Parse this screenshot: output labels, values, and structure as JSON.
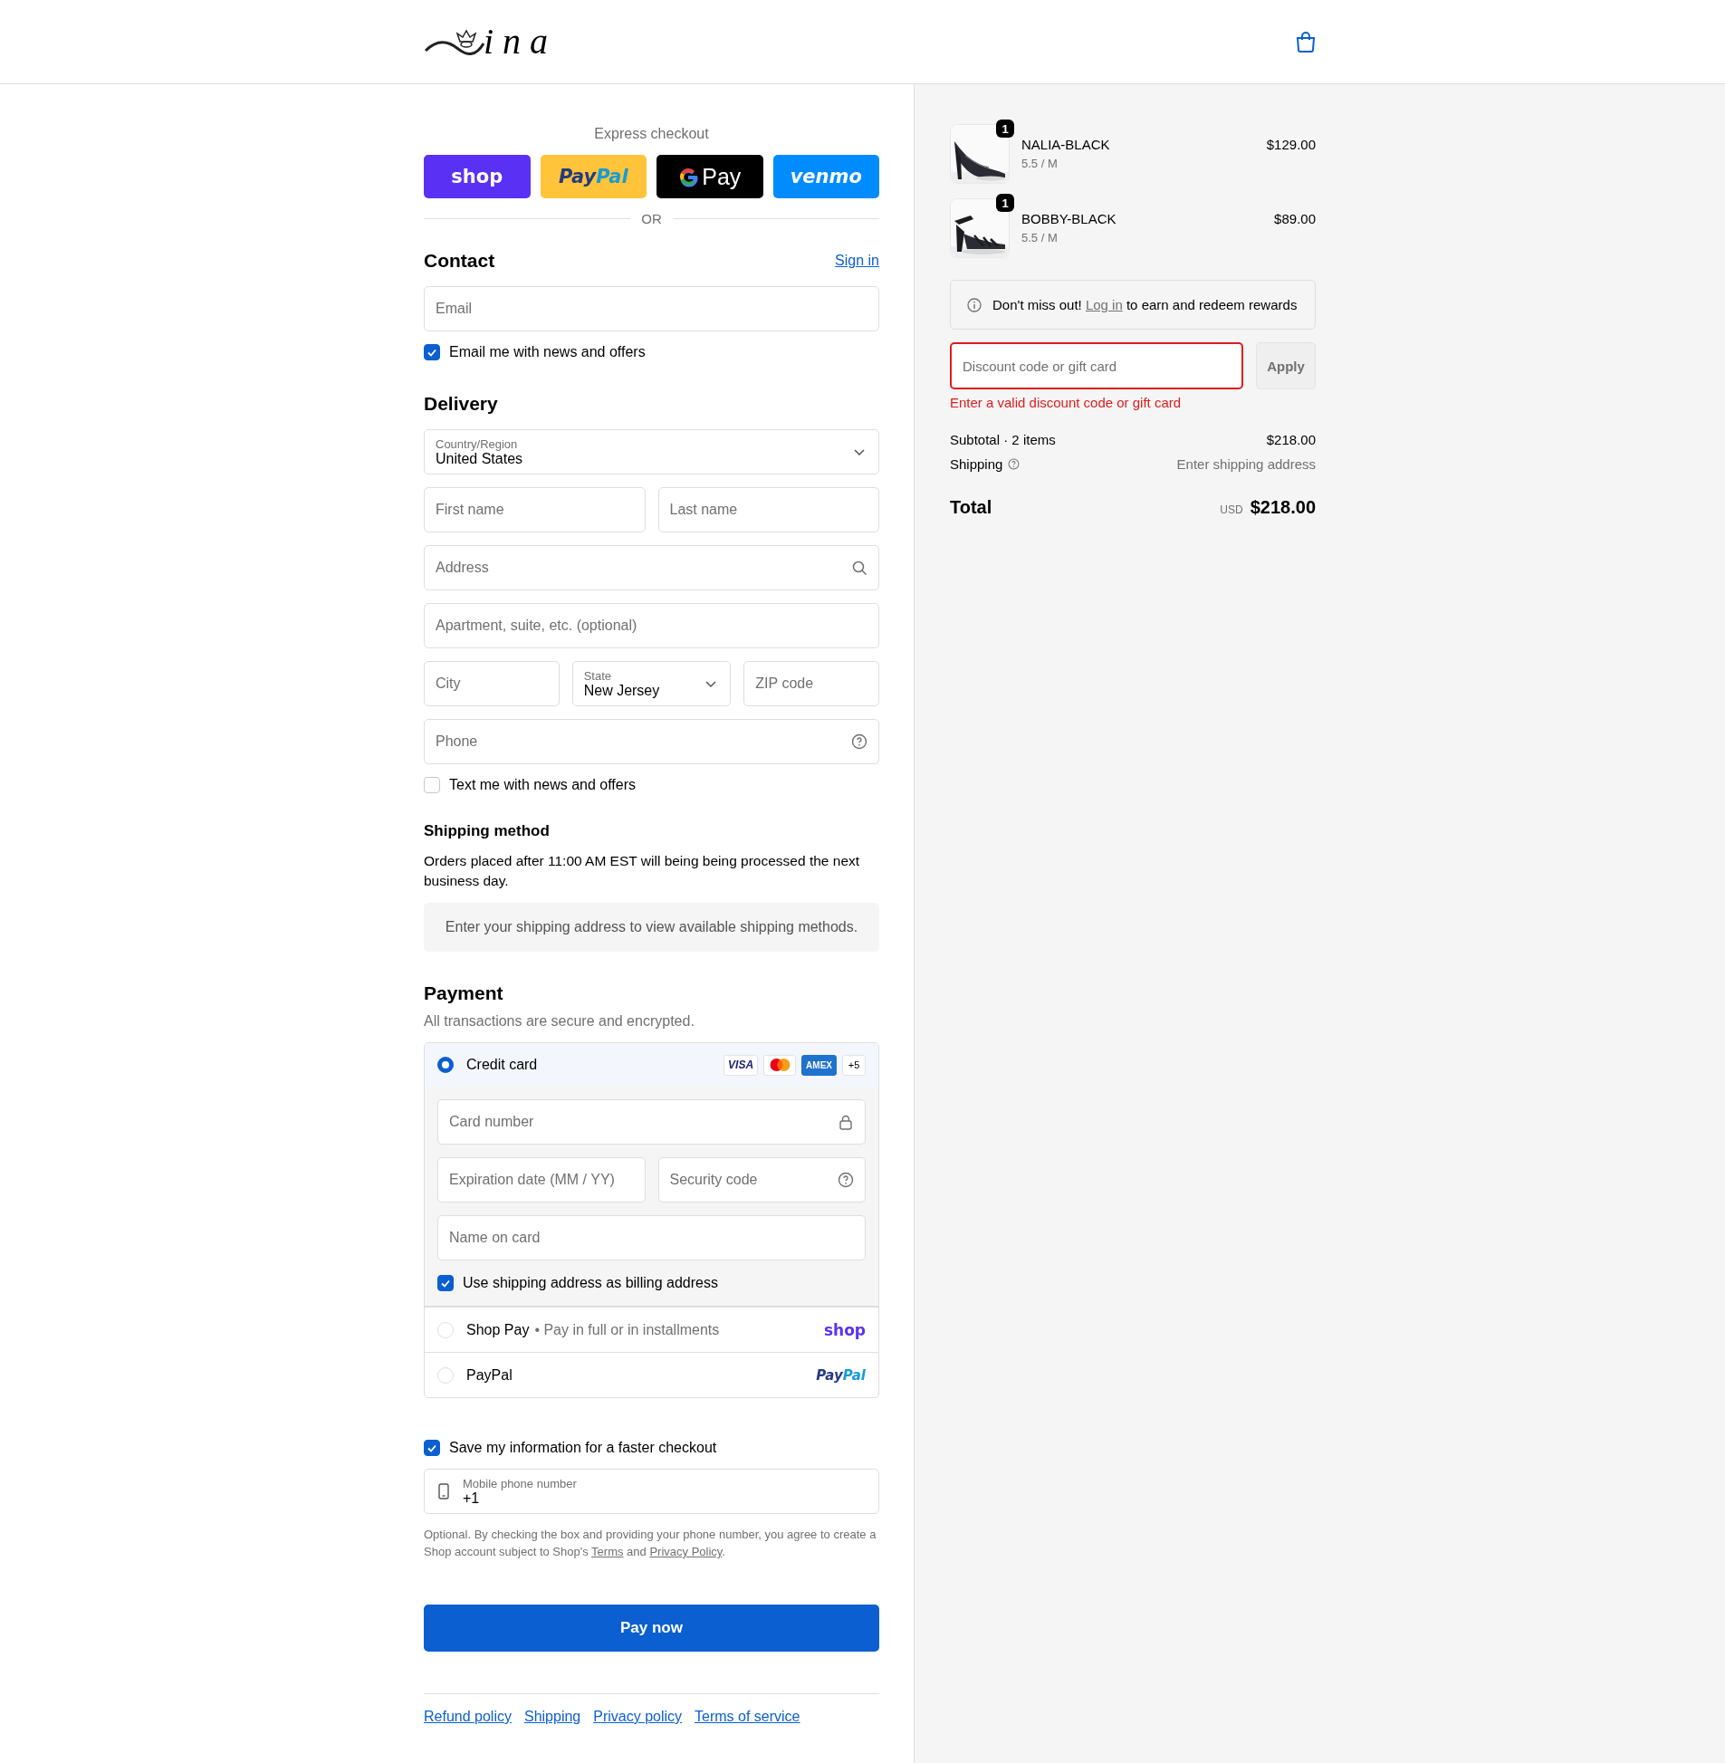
{
  "header": {
    "logo_text": "ina"
  },
  "express_checkout": {
    "label": "Express checkout",
    "buttons": [
      {
        "kind": "shop",
        "label": "shop"
      },
      {
        "kind": "paypal",
        "label_parts": [
          "Pay",
          "Pal"
        ]
      },
      {
        "kind": "gpay",
        "label": "Pay"
      },
      {
        "kind": "venmo",
        "label": "venmo"
      }
    ],
    "divider": "OR"
  },
  "contact": {
    "title": "Contact",
    "sign_in": "Sign in",
    "email": {
      "placeholder": "Email"
    },
    "news": {
      "label": "Email me with news and offers",
      "checked": true
    }
  },
  "delivery": {
    "title": "Delivery",
    "rows": [
      [
        {
          "kind": "select",
          "label": "Country/Region",
          "value": "United States"
        }
      ],
      [
        {
          "kind": "text",
          "placeholder": "First name"
        },
        {
          "kind": "text",
          "placeholder": "Last name"
        }
      ],
      [
        {
          "kind": "search",
          "placeholder": "Address"
        }
      ],
      [
        {
          "kind": "text",
          "placeholder": "Apartment, suite, etc. (optional)"
        }
      ],
      [
        {
          "kind": "text",
          "placeholder": "City"
        },
        {
          "kind": "select",
          "label": "State",
          "value": "New Jersey"
        },
        {
          "kind": "text",
          "placeholder": "ZIP code"
        }
      ],
      [
        {
          "kind": "help",
          "placeholder": "Phone"
        }
      ]
    ],
    "text_news": {
      "label": "Text me with news and offers",
      "checked": false
    }
  },
  "shipping_method": {
    "title": "Shipping method",
    "note": "Orders placed after 11:00 AM EST will being being processed the next business day.",
    "empty": "Enter your shipping address to view available shipping methods."
  },
  "payment": {
    "title": "Payment",
    "subtitle": "All transactions are secure and encrypted.",
    "methods": [
      {
        "kind": "card",
        "label": "Credit card",
        "selected": true,
        "brands": [
          {
            "kind": "visa",
            "label": "VISA"
          },
          {
            "kind": "mastercard"
          },
          {
            "kind": "amex",
            "label": "AMEX"
          },
          {
            "kind": "more",
            "label": "+5"
          }
        ],
        "fields": [
          [
            {
              "kind": "lock",
              "placeholder": "Card number"
            }
          ],
          [
            {
              "kind": "text",
              "placeholder": "Expiration date (MM / YY)"
            },
            {
              "kind": "help",
              "placeholder": "Security code"
            }
          ],
          [
            {
              "kind": "text",
              "placeholder": "Name on card"
            }
          ]
        ],
        "billing": {
          "label": "Use shipping address as billing address",
          "checked": true
        }
      },
      {
        "kind": "shoppay",
        "label": "Shop Pay",
        "detail": "• Pay in full or in installments",
        "selected": false,
        "logo": "shop"
      },
      {
        "kind": "paypal",
        "label": "PayPal",
        "selected": false,
        "logo_parts": [
          "Pay",
          "Pal"
        ]
      }
    ]
  },
  "save_info": {
    "label": "Save my information for a faster checkout",
    "checked": true,
    "mobile": {
      "label": "Mobile phone number",
      "value": "+1"
    },
    "legal": {
      "before": "Optional. By checking the box and providing your phone number, you agree to create a Shop account subject to Shop's ",
      "terms": "Terms",
      "middle": " and ",
      "privacy": "Privacy Policy",
      "after": "."
    }
  },
  "pay_button": "Pay now",
  "footer_links": [
    "Refund policy",
    "Shipping",
    "Privacy policy",
    "Terms of service"
  ],
  "summary": {
    "items": [
      {
        "name": "NALIA-BLACK",
        "variant": "5.5 / M",
        "price": "$129.00",
        "quantity": "1",
        "kind": "pump"
      },
      {
        "name": "BOBBY-BLACK",
        "variant": "5.5 / M",
        "price": "$89.00",
        "quantity": "1",
        "kind": "sandal"
      }
    ],
    "rewards": {
      "before": "Don't miss out! ",
      "link": "Log in",
      "after": " to earn and redeem rewards"
    },
    "discount": {
      "placeholder": "Discount code or gift card",
      "button": "Apply",
      "error": "Enter a valid discount code or gift card"
    },
    "subtotal": {
      "label": "Subtotal · 2 items",
      "value": "$218.00"
    },
    "shipping": {
      "label": "Shipping",
      "value": "Enter shipping address"
    },
    "total": {
      "label": "Total",
      "currency": "USD",
      "value": "$218.00"
    }
  }
}
